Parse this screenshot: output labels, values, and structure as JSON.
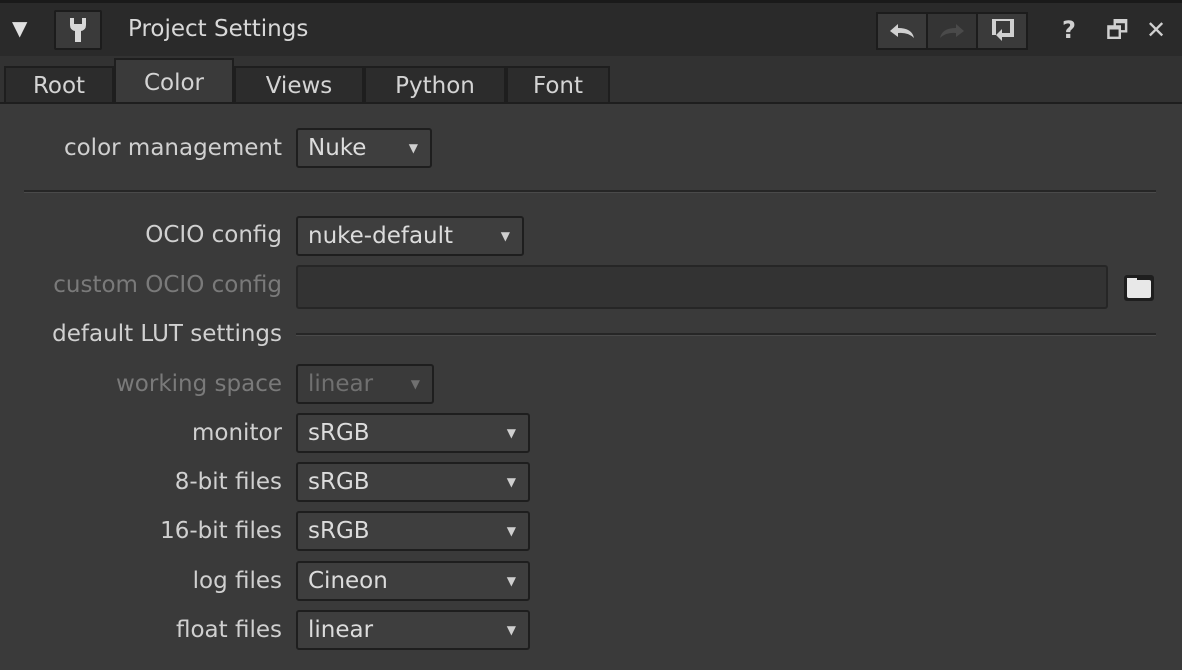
{
  "window": {
    "title": "Project Settings",
    "collapse_icon": "triangle-down-icon",
    "help_label": "?",
    "float_label": "🗗",
    "close_label": "✕"
  },
  "tabs": [
    {
      "label": "Root"
    },
    {
      "label": "Color"
    },
    {
      "label": "Views"
    },
    {
      "label": "Python"
    },
    {
      "label": "Font"
    }
  ],
  "active_tab": "Color",
  "fields": {
    "color_management": {
      "label": "color management",
      "value": "Nuke"
    },
    "ocio_config": {
      "label": "OCIO config",
      "value": "nuke-default"
    },
    "custom_ocio_config": {
      "label": "custom OCIO config",
      "value": ""
    },
    "section_title": "default LUT settings",
    "working_space": {
      "label": "working space",
      "value": "linear"
    },
    "monitor": {
      "label": "monitor",
      "value": "sRGB"
    },
    "bit8_files": {
      "label": "8-bit files",
      "value": "sRGB"
    },
    "bit16_files": {
      "label": "16-bit files",
      "value": "sRGB"
    },
    "log_files": {
      "label": "log files",
      "value": "Cineon"
    },
    "float_files": {
      "label": "float files",
      "value": "linear"
    }
  },
  "colors": {
    "panel_bg": "#3a3a3a",
    "titlebar_bg": "#2a2a2a",
    "text": "#d0d0d0",
    "disabled_text": "#7a7a7a"
  }
}
